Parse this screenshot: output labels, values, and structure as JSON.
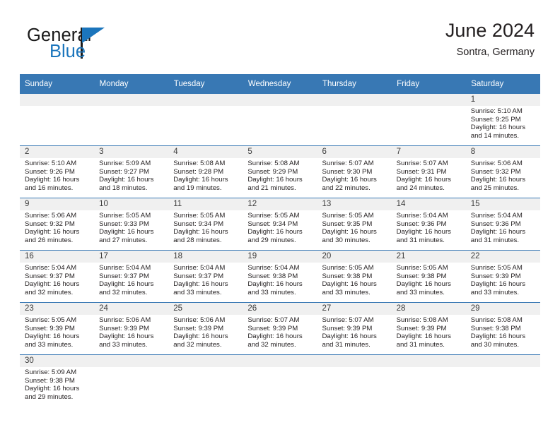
{
  "brand": {
    "name_top": "General",
    "name_bottom": "Blue",
    "accent_color": "#1b75bc",
    "flag_icon": "triangle-flag-icon"
  },
  "header": {
    "title": "June 2024",
    "subtitle": "Sontra, Germany",
    "header_bg_color": "#3878b4",
    "daynum_bg_color": "#f0f0f0"
  },
  "calendar": {
    "weekday_headers": [
      "Sunday",
      "Monday",
      "Tuesday",
      "Wednesday",
      "Thursday",
      "Friday",
      "Saturday"
    ],
    "labels": {
      "sunrise": "Sunrise:",
      "sunset": "Sunset:",
      "daylight": "Daylight:"
    },
    "weeks": [
      [
        {
          "day": "",
          "empty": true
        },
        {
          "day": "",
          "empty": true
        },
        {
          "day": "",
          "empty": true
        },
        {
          "day": "",
          "empty": true
        },
        {
          "day": "",
          "empty": true
        },
        {
          "day": "",
          "empty": true
        },
        {
          "day": "1",
          "sunrise": "Sunrise: 5:10 AM",
          "sunset": "Sunset: 9:25 PM",
          "daylight_1": "Daylight: 16 hours",
          "daylight_2": "and 14 minutes."
        }
      ],
      [
        {
          "day": "2",
          "sunrise": "Sunrise: 5:10 AM",
          "sunset": "Sunset: 9:26 PM",
          "daylight_1": "Daylight: 16 hours",
          "daylight_2": "and 16 minutes."
        },
        {
          "day": "3",
          "sunrise": "Sunrise: 5:09 AM",
          "sunset": "Sunset: 9:27 PM",
          "daylight_1": "Daylight: 16 hours",
          "daylight_2": "and 18 minutes."
        },
        {
          "day": "4",
          "sunrise": "Sunrise: 5:08 AM",
          "sunset": "Sunset: 9:28 PM",
          "daylight_1": "Daylight: 16 hours",
          "daylight_2": "and 19 minutes."
        },
        {
          "day": "5",
          "sunrise": "Sunrise: 5:08 AM",
          "sunset": "Sunset: 9:29 PM",
          "daylight_1": "Daylight: 16 hours",
          "daylight_2": "and 21 minutes."
        },
        {
          "day": "6",
          "sunrise": "Sunrise: 5:07 AM",
          "sunset": "Sunset: 9:30 PM",
          "daylight_1": "Daylight: 16 hours",
          "daylight_2": "and 22 minutes."
        },
        {
          "day": "7",
          "sunrise": "Sunrise: 5:07 AM",
          "sunset": "Sunset: 9:31 PM",
          "daylight_1": "Daylight: 16 hours",
          "daylight_2": "and 24 minutes."
        },
        {
          "day": "8",
          "sunrise": "Sunrise: 5:06 AM",
          "sunset": "Sunset: 9:32 PM",
          "daylight_1": "Daylight: 16 hours",
          "daylight_2": "and 25 minutes."
        }
      ],
      [
        {
          "day": "9",
          "sunrise": "Sunrise: 5:06 AM",
          "sunset": "Sunset: 9:32 PM",
          "daylight_1": "Daylight: 16 hours",
          "daylight_2": "and 26 minutes."
        },
        {
          "day": "10",
          "sunrise": "Sunrise: 5:05 AM",
          "sunset": "Sunset: 9:33 PM",
          "daylight_1": "Daylight: 16 hours",
          "daylight_2": "and 27 minutes."
        },
        {
          "day": "11",
          "sunrise": "Sunrise: 5:05 AM",
          "sunset": "Sunset: 9:34 PM",
          "daylight_1": "Daylight: 16 hours",
          "daylight_2": "and 28 minutes."
        },
        {
          "day": "12",
          "sunrise": "Sunrise: 5:05 AM",
          "sunset": "Sunset: 9:34 PM",
          "daylight_1": "Daylight: 16 hours",
          "daylight_2": "and 29 minutes."
        },
        {
          "day": "13",
          "sunrise": "Sunrise: 5:05 AM",
          "sunset": "Sunset: 9:35 PM",
          "daylight_1": "Daylight: 16 hours",
          "daylight_2": "and 30 minutes."
        },
        {
          "day": "14",
          "sunrise": "Sunrise: 5:04 AM",
          "sunset": "Sunset: 9:36 PM",
          "daylight_1": "Daylight: 16 hours",
          "daylight_2": "and 31 minutes."
        },
        {
          "day": "15",
          "sunrise": "Sunrise: 5:04 AM",
          "sunset": "Sunset: 9:36 PM",
          "daylight_1": "Daylight: 16 hours",
          "daylight_2": "and 31 minutes."
        }
      ],
      [
        {
          "day": "16",
          "sunrise": "Sunrise: 5:04 AM",
          "sunset": "Sunset: 9:37 PM",
          "daylight_1": "Daylight: 16 hours",
          "daylight_2": "and 32 minutes."
        },
        {
          "day": "17",
          "sunrise": "Sunrise: 5:04 AM",
          "sunset": "Sunset: 9:37 PM",
          "daylight_1": "Daylight: 16 hours",
          "daylight_2": "and 32 minutes."
        },
        {
          "day": "18",
          "sunrise": "Sunrise: 5:04 AM",
          "sunset": "Sunset: 9:37 PM",
          "daylight_1": "Daylight: 16 hours",
          "daylight_2": "and 33 minutes."
        },
        {
          "day": "19",
          "sunrise": "Sunrise: 5:04 AM",
          "sunset": "Sunset: 9:38 PM",
          "daylight_1": "Daylight: 16 hours",
          "daylight_2": "and 33 minutes."
        },
        {
          "day": "20",
          "sunrise": "Sunrise: 5:05 AM",
          "sunset": "Sunset: 9:38 PM",
          "daylight_1": "Daylight: 16 hours",
          "daylight_2": "and 33 minutes."
        },
        {
          "day": "21",
          "sunrise": "Sunrise: 5:05 AM",
          "sunset": "Sunset: 9:38 PM",
          "daylight_1": "Daylight: 16 hours",
          "daylight_2": "and 33 minutes."
        },
        {
          "day": "22",
          "sunrise": "Sunrise: 5:05 AM",
          "sunset": "Sunset: 9:39 PM",
          "daylight_1": "Daylight: 16 hours",
          "daylight_2": "and 33 minutes."
        }
      ],
      [
        {
          "day": "23",
          "sunrise": "Sunrise: 5:05 AM",
          "sunset": "Sunset: 9:39 PM",
          "daylight_1": "Daylight: 16 hours",
          "daylight_2": "and 33 minutes."
        },
        {
          "day": "24",
          "sunrise": "Sunrise: 5:06 AM",
          "sunset": "Sunset: 9:39 PM",
          "daylight_1": "Daylight: 16 hours",
          "daylight_2": "and 33 minutes."
        },
        {
          "day": "25",
          "sunrise": "Sunrise: 5:06 AM",
          "sunset": "Sunset: 9:39 PM",
          "daylight_1": "Daylight: 16 hours",
          "daylight_2": "and 32 minutes."
        },
        {
          "day": "26",
          "sunrise": "Sunrise: 5:07 AM",
          "sunset": "Sunset: 9:39 PM",
          "daylight_1": "Daylight: 16 hours",
          "daylight_2": "and 32 minutes."
        },
        {
          "day": "27",
          "sunrise": "Sunrise: 5:07 AM",
          "sunset": "Sunset: 9:39 PM",
          "daylight_1": "Daylight: 16 hours",
          "daylight_2": "and 31 minutes."
        },
        {
          "day": "28",
          "sunrise": "Sunrise: 5:08 AM",
          "sunset": "Sunset: 9:39 PM",
          "daylight_1": "Daylight: 16 hours",
          "daylight_2": "and 31 minutes."
        },
        {
          "day": "29",
          "sunrise": "Sunrise: 5:08 AM",
          "sunset": "Sunset: 9:38 PM",
          "daylight_1": "Daylight: 16 hours",
          "daylight_2": "and 30 minutes."
        }
      ],
      [
        {
          "day": "30",
          "sunrise": "Sunrise: 5:09 AM",
          "sunset": "Sunset: 9:38 PM",
          "daylight_1": "Daylight: 16 hours",
          "daylight_2": "and 29 minutes."
        },
        {
          "day": "",
          "empty": true
        },
        {
          "day": "",
          "empty": true
        },
        {
          "day": "",
          "empty": true
        },
        {
          "day": "",
          "empty": true
        },
        {
          "day": "",
          "empty": true
        },
        {
          "day": "",
          "empty": true
        }
      ]
    ]
  }
}
